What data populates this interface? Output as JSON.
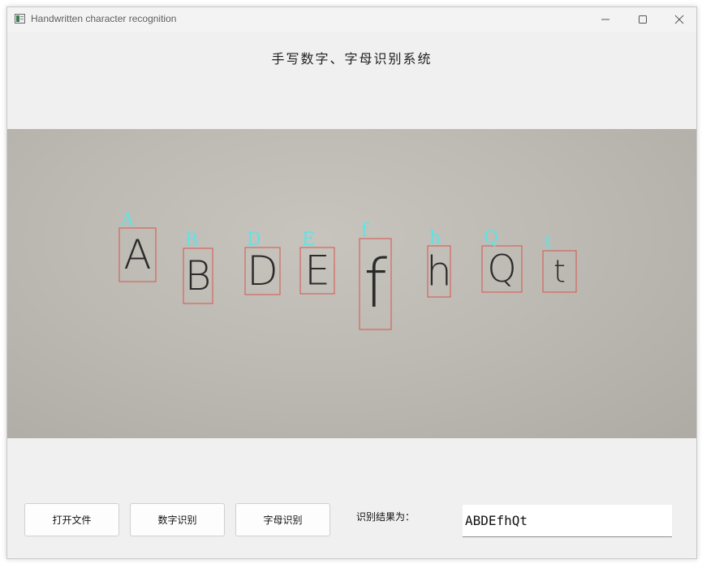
{
  "window": {
    "title": "Handwritten character recognition",
    "controls": [
      "minimize-icon",
      "maximize-icon",
      "close-icon"
    ]
  },
  "heading": "手写数字、字母识别系统",
  "image": {
    "description_icon": "handwritten-letters-photo",
    "detections": [
      {
        "label": "A",
        "glyph": "A"
      },
      {
        "label": "B",
        "glyph": "B"
      },
      {
        "label": "D",
        "glyph": "D"
      },
      {
        "label": "E",
        "glyph": "E"
      },
      {
        "label": "f",
        "glyph": "f"
      },
      {
        "label": "h",
        "glyph": "h"
      },
      {
        "label": "Q",
        "glyph": "Q"
      },
      {
        "label": "t",
        "glyph": "t"
      }
    ],
    "label_color": "#5ee3e6",
    "box_color": "#d9534f"
  },
  "buttons": {
    "open_file": "打开文件",
    "digit_recognition": "数字识别",
    "letter_recognition": "字母识别"
  },
  "result": {
    "label": "识别结果为：",
    "value": "ABDEfhQt"
  }
}
